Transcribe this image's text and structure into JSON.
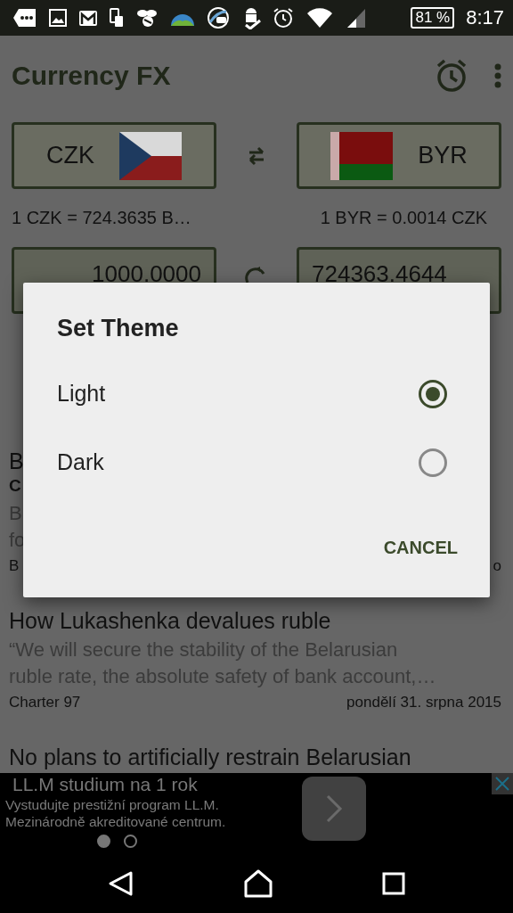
{
  "status_bar": {
    "battery": "81 %",
    "time": "8:17"
  },
  "toolbar": {
    "title": "Currency FX"
  },
  "converter": {
    "from": {
      "code": "CZK"
    },
    "to": {
      "code": "BYR"
    },
    "from_rate": "1 CZK = 724.3635 B…",
    "to_rate": "1 BYR = 0.0014 CZK",
    "from_amount": "1000.0000",
    "to_amount": "724363.4644"
  },
  "news": [
    {
      "title": "B",
      "subtitle": "C",
      "summary": [
        "B",
        "fo"
      ],
      "source": "B",
      "date": "o"
    },
    {
      "title": "How Lukashenka devalues ruble",
      "summary": [
        "“We will secure the stability of the Belarusian",
        "ruble rate, the absolute safety of bank account,…"
      ],
      "source": "Charter 97",
      "date": "pondělí 31. srpna 2015"
    },
    {
      "title": "No plans to artificially restrain Belarusian"
    }
  ],
  "dialog": {
    "title": "Set Theme",
    "options": [
      {
        "label": "Light",
        "selected": true
      },
      {
        "label": "Dark",
        "selected": false
      }
    ],
    "button": "CANCEL"
  },
  "ad": {
    "title": "LL.M studium na 1 rok",
    "lines": [
      "Vystudujte prestižní program LL.M.",
      "Mezinárodně akreditované centrum."
    ],
    "pages": [
      {
        "selected": true
      },
      {
        "selected": false
      }
    ]
  }
}
